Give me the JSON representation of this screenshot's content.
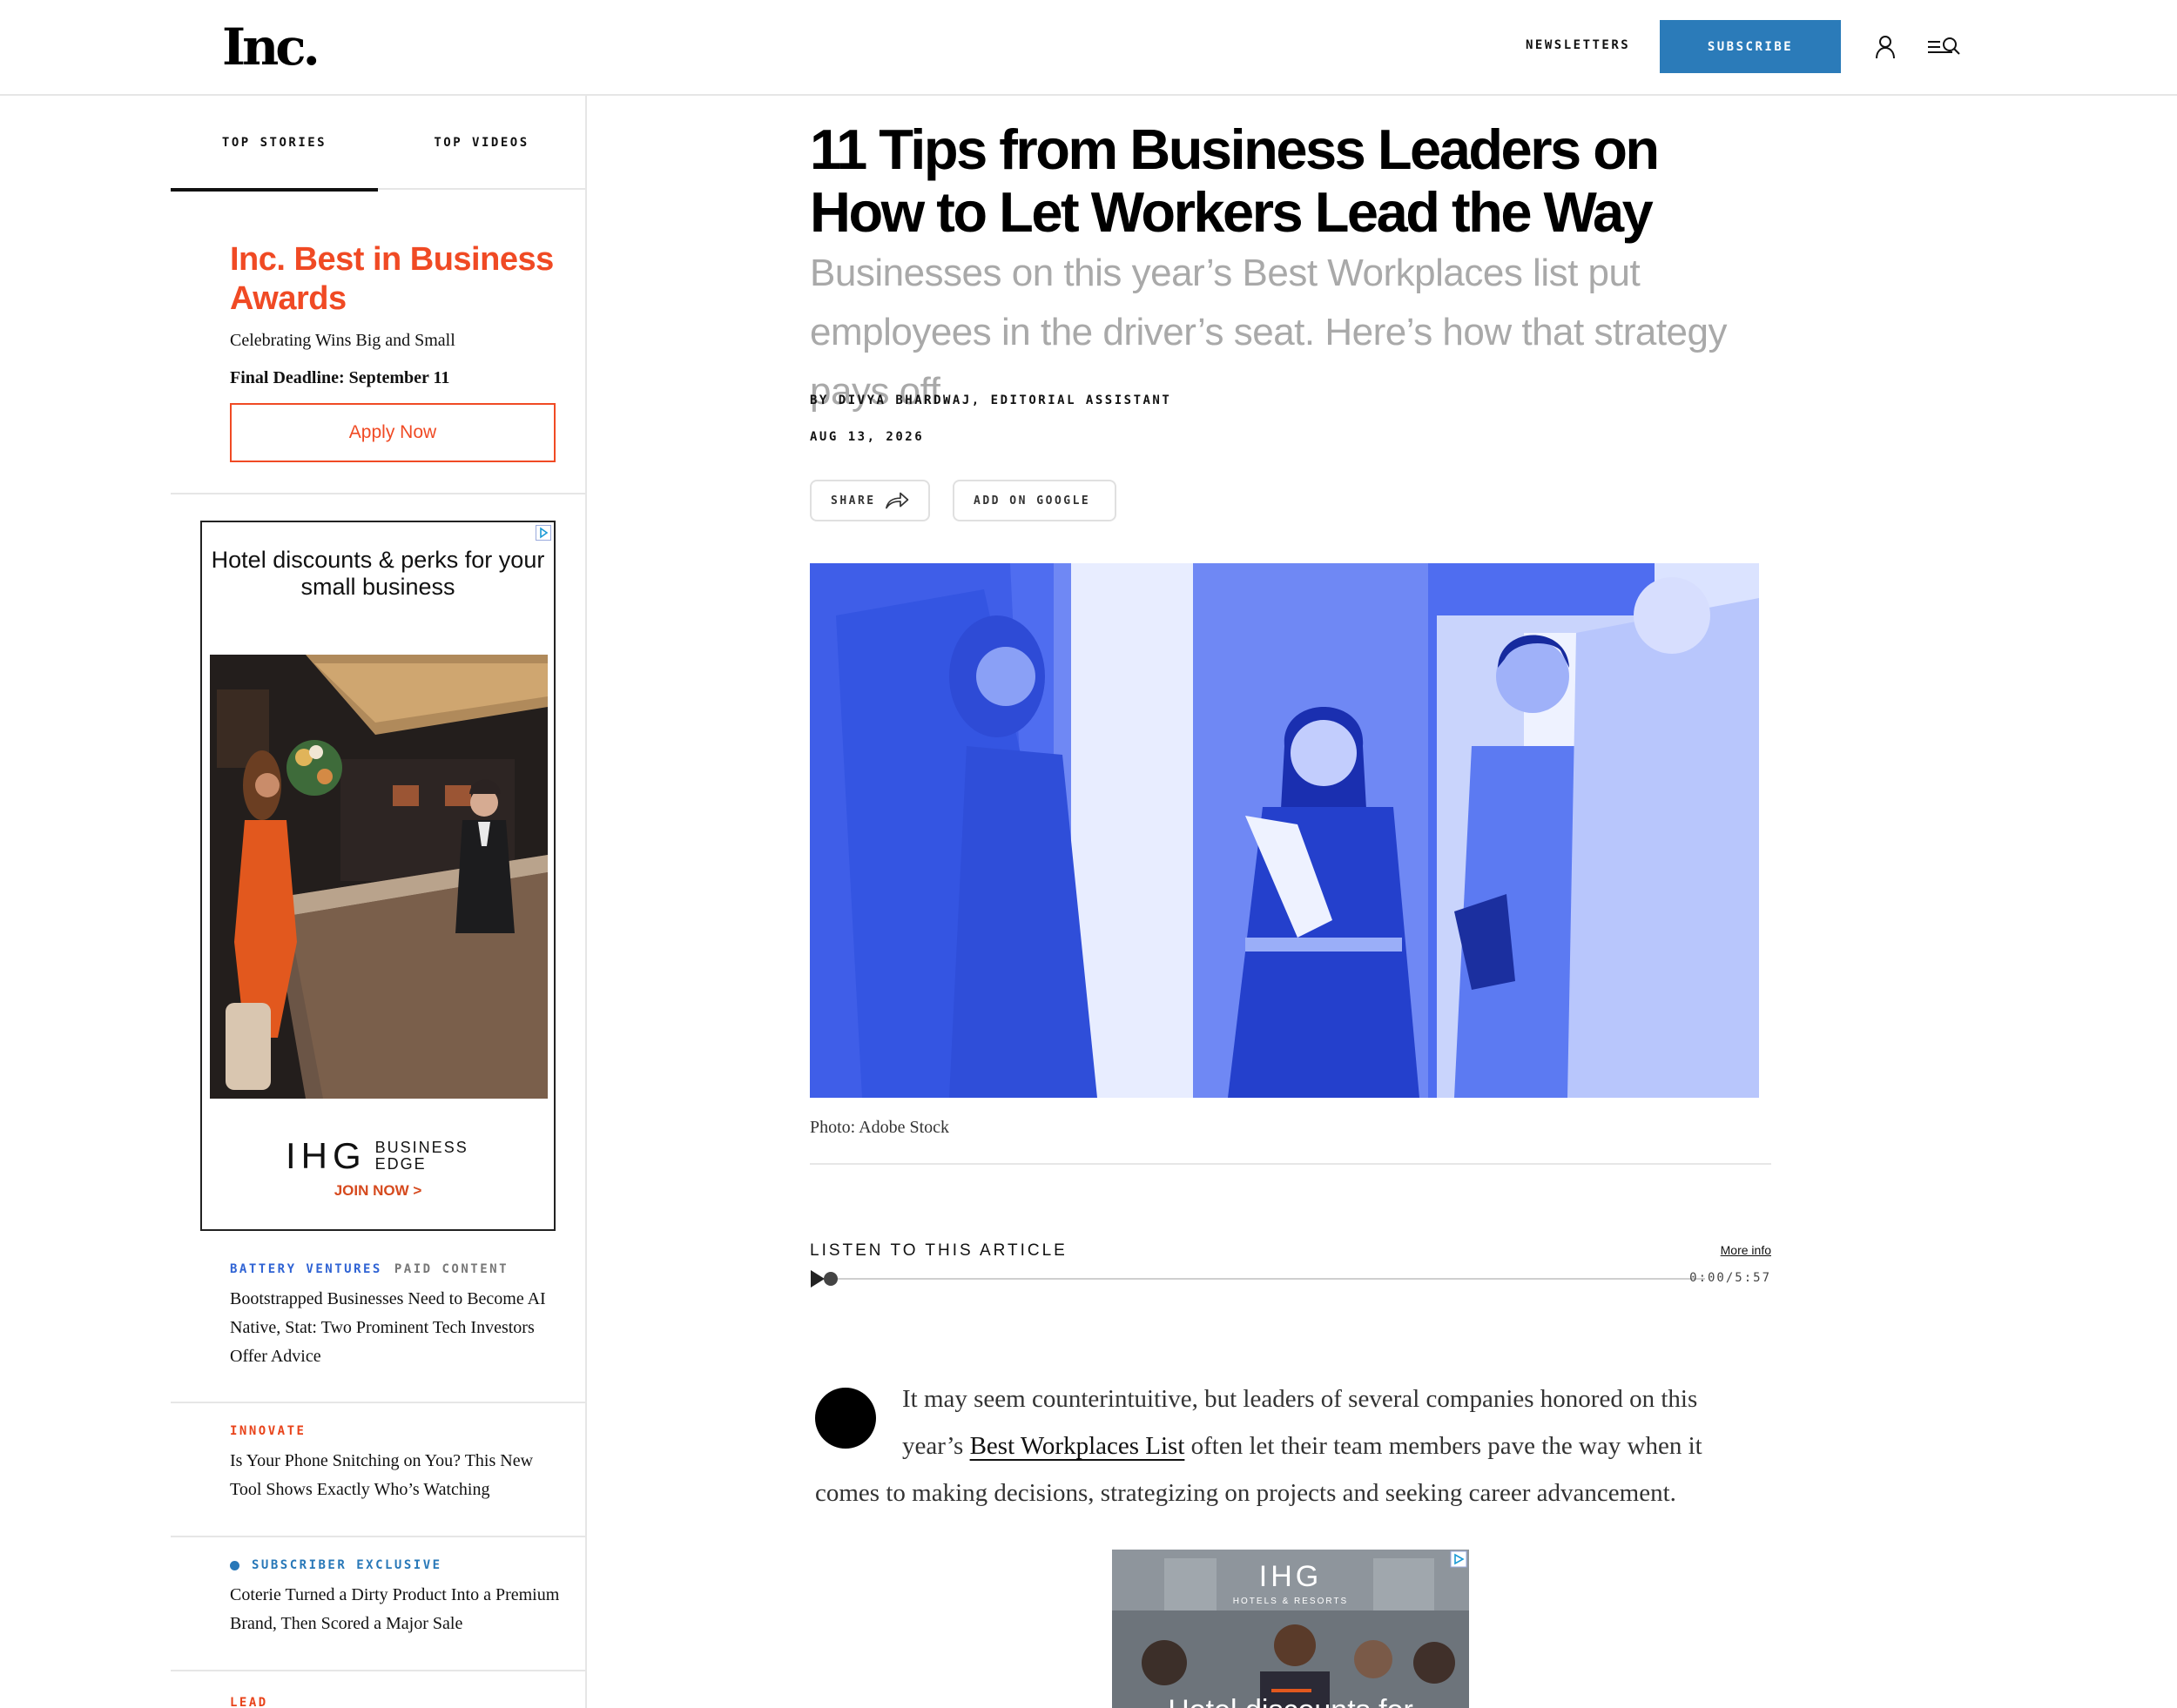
{
  "header": {
    "logo": "Inc.",
    "newsletters_label": "NEWSLETTERS",
    "subscribe_label": "SUBSCRIBE"
  },
  "sidebar": {
    "tabs": [
      {
        "label": "TOP STORIES",
        "active": true
      },
      {
        "label": "TOP VIDEOS",
        "active": false
      }
    ],
    "promo": {
      "title": "Inc. Best in Business Awards",
      "subtitle": "Celebrating Wins Big and Small",
      "deadline": "Final Deadline: September 11",
      "button_label": "Apply Now"
    },
    "ad": {
      "headline": "Hotel discounts & perks for your small business",
      "brand": "IHG",
      "brand_sub": "BUSINESS EDGE",
      "cta": "JOIN NOW >"
    },
    "stories": [
      {
        "kicker": "BATTERY VENTURES",
        "kicker_extra": "PAID CONTENT",
        "title": "Bootstrapped Businesses Need to Become AI Native, Stat: Two Prominent Tech Investors Offer Advice"
      },
      {
        "kicker": "INNOVATE",
        "title": "Is Your Phone Snitching on You? This New Tool Shows Exactly Who’s Watching"
      },
      {
        "kicker": "SUBSCRIBER EXCLUSIVE",
        "title": "Coterie Turned a Dirty Product Into a Premium Brand, Then Scored a Major Sale"
      },
      {
        "kicker": "LEAD"
      }
    ]
  },
  "article": {
    "headline": "11 Tips from Business Leaders on How to Let Workers Lead the Way",
    "dek": "Businesses on this year’s Best Workplaces list put employees in the driver’s seat. Here’s how that strategy pays off.",
    "byline": "BY DIVYA BHARDWAJ, EDITORIAL ASSISTANT",
    "date": "AUG 13, 2026",
    "share_label": "SHARE",
    "google_label": "ADD ON GOOGLE",
    "photo_caption": "Photo: Adobe Stock",
    "listen": {
      "label": "LISTEN TO THIS ARTICLE",
      "more_info": "More info",
      "time": "0:00/5:57",
      "progress": 0
    },
    "body": {
      "before_link": "It may seem counterintuitive, but leaders of several companies honored on this year’s ",
      "link_text": "Best Workplaces List",
      "after_link": " often let their team members pave the way when it comes to making decisions, strategizing on projects and seeking career advancement."
    },
    "inline_ad": {
      "brand": "IHG",
      "brand_sub": "HOTELS & RESORTS",
      "headline_partial": "Hotel discounts for"
    }
  },
  "colors": {
    "brand_orange": "#f04a24",
    "subscribe_blue": "#2b7bb9",
    "kicker_blue": "#2f63d4",
    "hero_tint": "#4f6df0"
  },
  "icons": [
    "user-icon",
    "menu-search-icon",
    "share-arrow-icon",
    "ad-choices-icon",
    "play-icon"
  ]
}
